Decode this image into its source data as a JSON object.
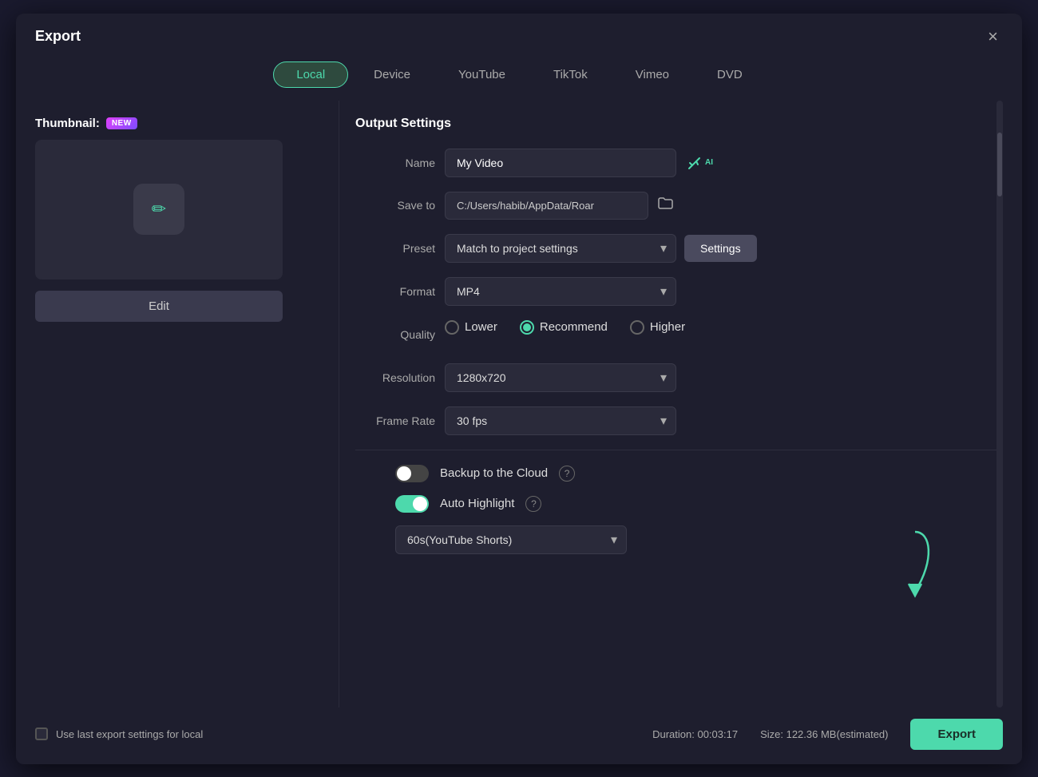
{
  "dialog": {
    "title": "Export",
    "close_label": "×"
  },
  "tabs": [
    {
      "id": "local",
      "label": "Local",
      "active": true
    },
    {
      "id": "device",
      "label": "Device",
      "active": false
    },
    {
      "id": "youtube",
      "label": "YouTube",
      "active": false
    },
    {
      "id": "tiktok",
      "label": "TikTok",
      "active": false
    },
    {
      "id": "vimeo",
      "label": "Vimeo",
      "active": false
    },
    {
      "id": "dvd",
      "label": "DVD",
      "active": false
    }
  ],
  "left_panel": {
    "thumbnail_label": "Thumbnail:",
    "new_badge": "NEW",
    "edit_button": "Edit"
  },
  "right_panel": {
    "output_settings_title": "Output Settings",
    "name_label": "Name",
    "name_value": "My Video",
    "save_to_label": "Save to",
    "save_to_value": "C:/Users/habib/AppData/Roar",
    "preset_label": "Preset",
    "preset_value": "Match to project settings",
    "settings_btn": "Settings",
    "format_label": "Format",
    "format_value": "MP4",
    "quality_label": "Quality",
    "quality_options": [
      {
        "id": "lower",
        "label": "Lower",
        "checked": false
      },
      {
        "id": "recommend",
        "label": "Recommend",
        "checked": true
      },
      {
        "id": "higher",
        "label": "Higher",
        "checked": false
      }
    ],
    "resolution_label": "Resolution",
    "resolution_value": "1280x720",
    "frame_rate_label": "Frame Rate",
    "frame_rate_value": "30 fps",
    "backup_label": "Backup to the Cloud",
    "backup_on": false,
    "auto_highlight_label": "Auto Highlight",
    "auto_highlight_on": true,
    "highlight_duration_value": "60s(YouTube Shorts)"
  },
  "bottom": {
    "use_last_label": "Use last export settings for local",
    "duration_label": "Duration: 00:03:17",
    "size_label": "Size: 122.36 MB(estimated)",
    "export_button": "Export"
  }
}
